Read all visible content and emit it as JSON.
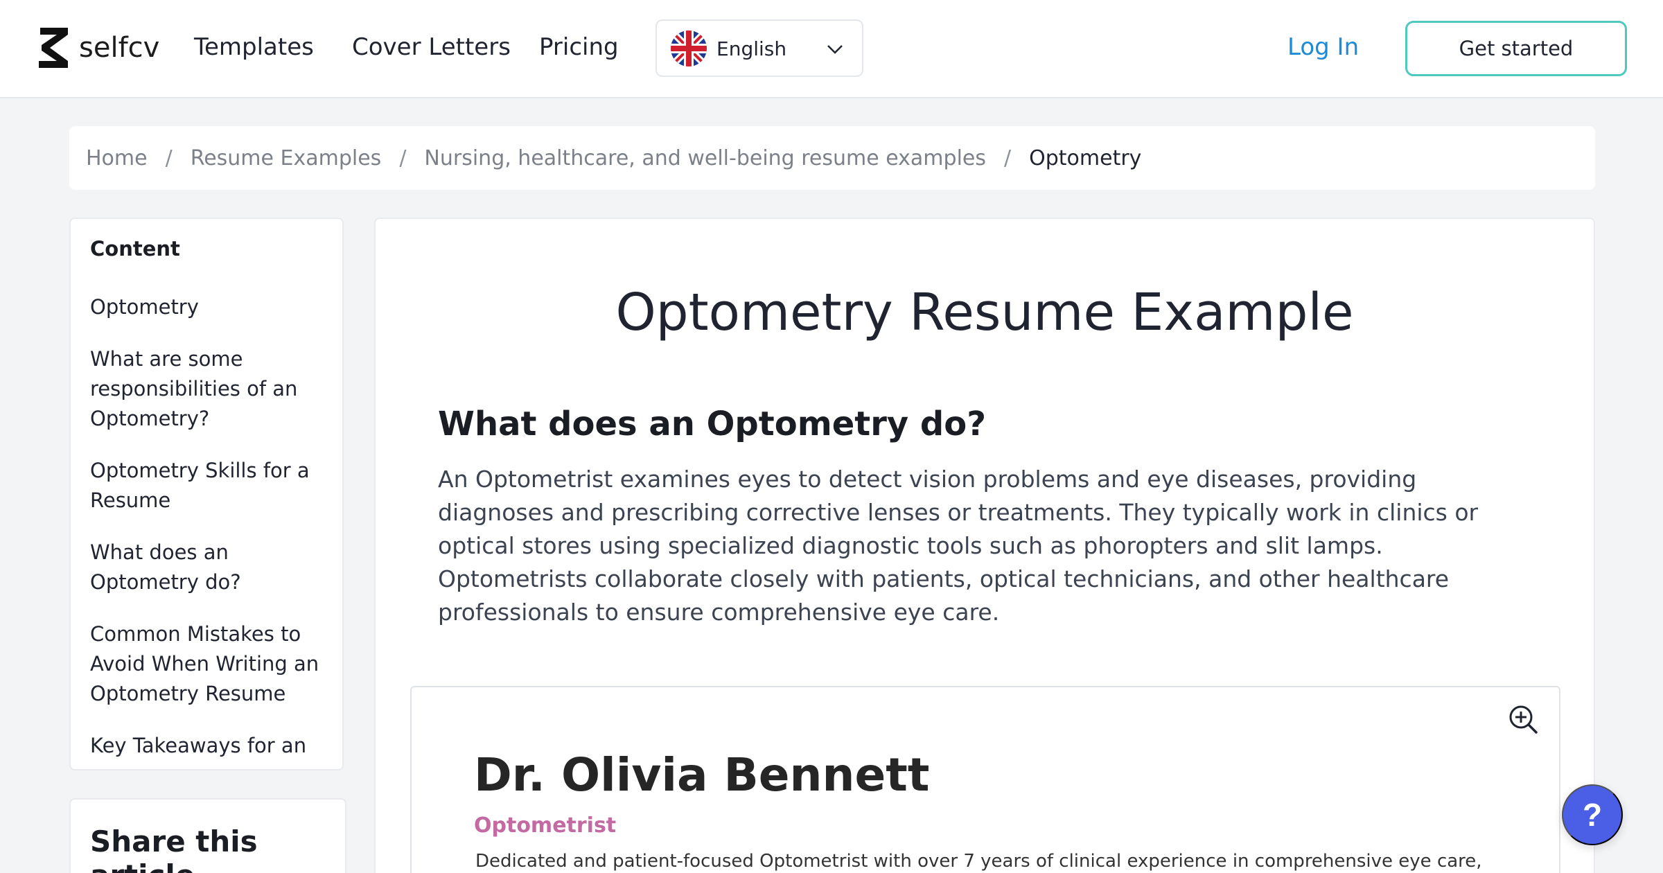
{
  "header": {
    "brand": "selfcv",
    "nav": [
      "Templates",
      "Cover Letters",
      "Pricing"
    ],
    "language": {
      "label": "English",
      "flag_icon": "uk-flag-icon"
    },
    "login": "Log In",
    "cta": "Get started",
    "colors": {
      "login": "#1d8ad6",
      "cta_border": "#4ec9c0"
    }
  },
  "breadcrumb": {
    "items": [
      "Home",
      "Resume Examples",
      "Nursing, healthcare, and well-being resume examples",
      "Optometry"
    ],
    "separator": "/"
  },
  "toc": {
    "title": "Content",
    "items": [
      "Optometry",
      "What are some responsibilities of an Optometry?",
      "Optometry Skills for a Resume",
      "What does an Optometry do?",
      "Common Mistakes to Avoid When Writing an Optometry Resume",
      "Key Takeaways for an"
    ]
  },
  "share": {
    "title": "Share this article"
  },
  "article": {
    "title": "Optometry Resume Example",
    "section_heading": "What does an Optometry do?",
    "section_body": "An Optometrist examines eyes to detect vision problems and eye diseases, providing diagnoses and prescribing corrective lenses or treatments. They typically work in clinics or optical stores using specialized diagnostic tools such as phoropters and slit lamps. Optometrists collaborate closely with patients, optical technicians, and other healthcare professionals to ensure comprehensive eye care.",
    "resume": {
      "name": "Dr. Olivia Bennett",
      "role": "Optometrist",
      "summary": "Dedicated and patient-focused Optometrist with over 7 years of clinical experience in comprehensive eye care,",
      "zoom_icon": "zoom-in-icon",
      "role_color": "#c46aa3"
    }
  },
  "help": {
    "label": "?",
    "color": "#4a5ee6"
  }
}
